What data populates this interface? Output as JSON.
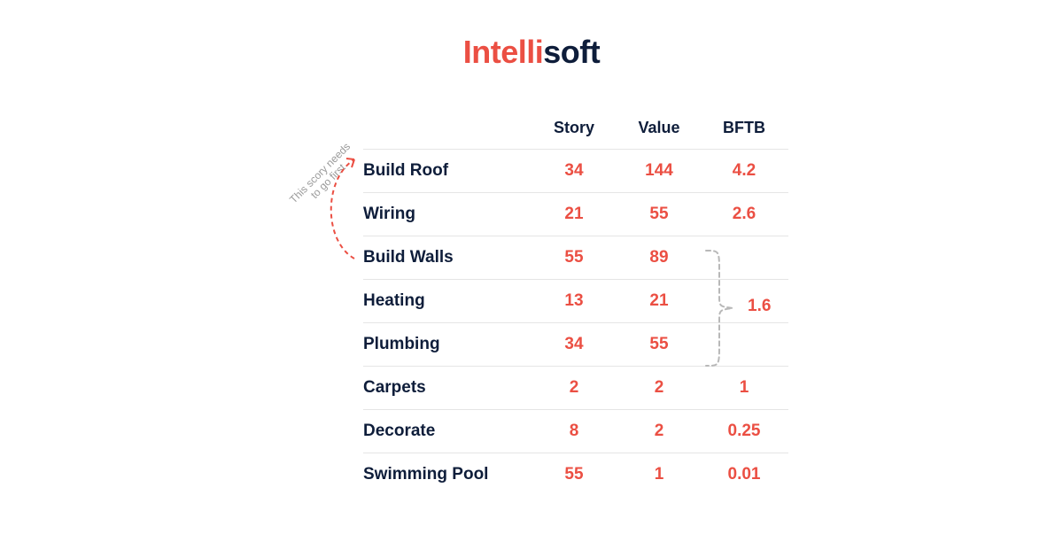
{
  "brand": {
    "part1": "Intelli",
    "part2": "soft"
  },
  "headers": {
    "col1": "Story",
    "col2": "Value",
    "col3": "BFTB"
  },
  "rows": [
    {
      "name": "Build Roof",
      "story": "34",
      "value": "144",
      "bftb": "4.2"
    },
    {
      "name": "Wiring",
      "story": "21",
      "value": "55",
      "bftb": "2.6"
    },
    {
      "name": "Build Walls",
      "story": "55",
      "value": "89",
      "bftb": ""
    },
    {
      "name": "Heating",
      "story": "13",
      "value": "21",
      "bftb": ""
    },
    {
      "name": "Plumbing",
      "story": "34",
      "value": "55",
      "bftb": ""
    },
    {
      "name": "Carpets",
      "story": "2",
      "value": "2",
      "bftb": "1"
    },
    {
      "name": "Decorate",
      "story": "8",
      "value": "2",
      "bftb": "0.25"
    },
    {
      "name": "Swimming Pool",
      "story": "55",
      "value": "1",
      "bftb": "0.01"
    }
  ],
  "group_bftb": "1.6",
  "annotation": "This scory needs\nto go first"
}
